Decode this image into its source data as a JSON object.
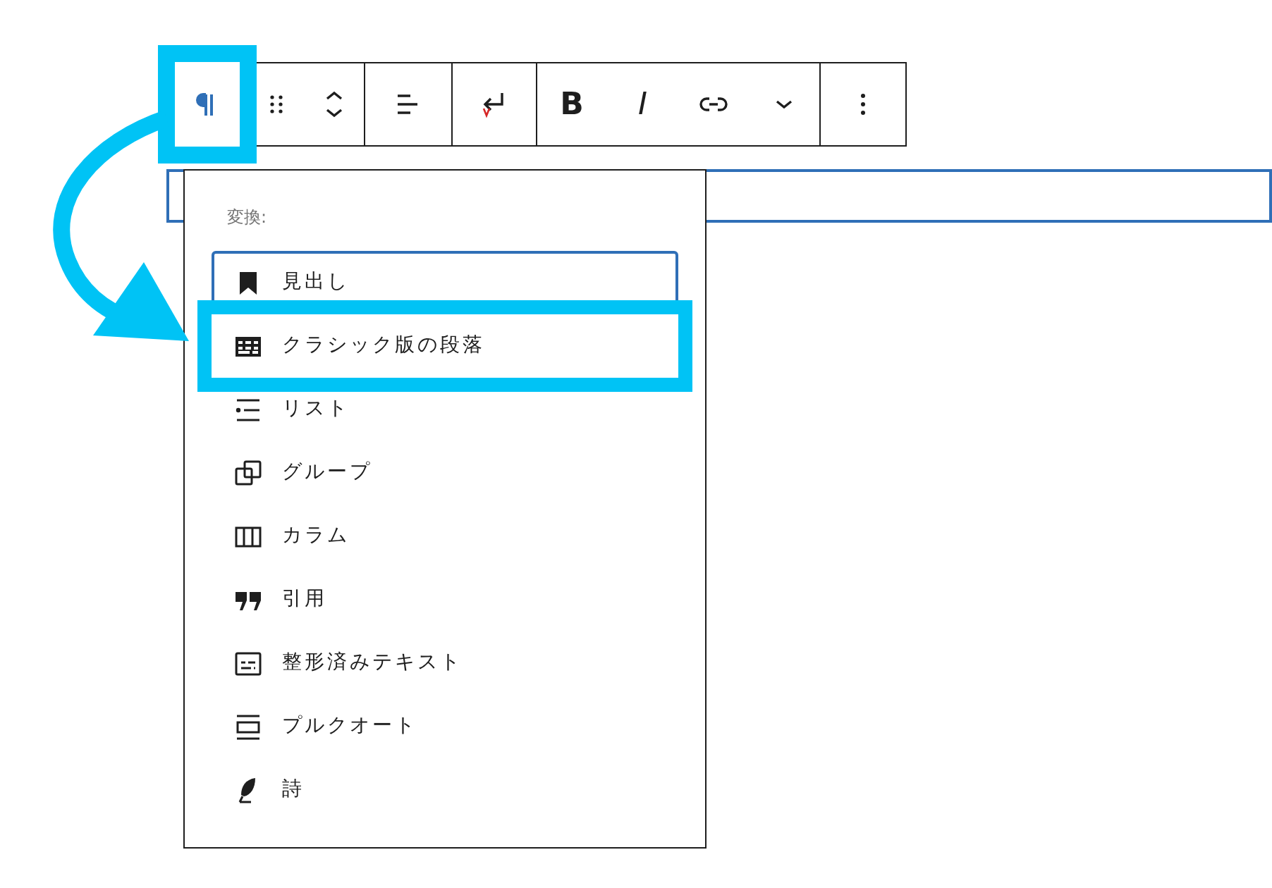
{
  "toolbar": {
    "groups": [
      {
        "buttons": [
          {
            "kind": "paragraph",
            "highlighted": true
          }
        ]
      },
      {
        "buttons": [
          {
            "kind": "drag",
            "highlighted": false
          },
          {
            "kind": "move",
            "highlighted": false
          }
        ]
      },
      {
        "buttons": [
          {
            "kind": "align",
            "highlighted": false
          }
        ]
      },
      {
        "buttons": [
          {
            "kind": "return",
            "highlighted": false
          }
        ]
      },
      {
        "buttons": [
          {
            "kind": "bold",
            "label": "B",
            "highlighted": false
          },
          {
            "kind": "italic",
            "label": "I",
            "highlighted": false
          },
          {
            "kind": "link",
            "highlighted": false
          },
          {
            "kind": "chevron",
            "highlighted": false
          }
        ]
      },
      {
        "buttons": [
          {
            "kind": "more",
            "highlighted": false
          }
        ]
      }
    ]
  },
  "transform_menu": {
    "label": "変換:",
    "items": [
      {
        "kind": "heading",
        "label": "見出し",
        "focused": true,
        "highlighted": false
      },
      {
        "kind": "classic",
        "label": "クラシック版の段落",
        "focused": false,
        "highlighted": true
      },
      {
        "kind": "list",
        "label": "リスト",
        "focused": false,
        "highlighted": false
      },
      {
        "kind": "group",
        "label": "グループ",
        "focused": false,
        "highlighted": false
      },
      {
        "kind": "columns",
        "label": "カラム",
        "focused": false,
        "highlighted": false
      },
      {
        "kind": "quote",
        "label": "引用",
        "focused": false,
        "highlighted": false
      },
      {
        "kind": "preformatted",
        "label": "整形済みテキスト",
        "focused": false,
        "highlighted": false
      },
      {
        "kind": "pullquote",
        "label": "プルクオート",
        "focused": false,
        "highlighted": false
      },
      {
        "kind": "verse",
        "label": "詩",
        "focused": false,
        "highlighted": false
      }
    ]
  }
}
